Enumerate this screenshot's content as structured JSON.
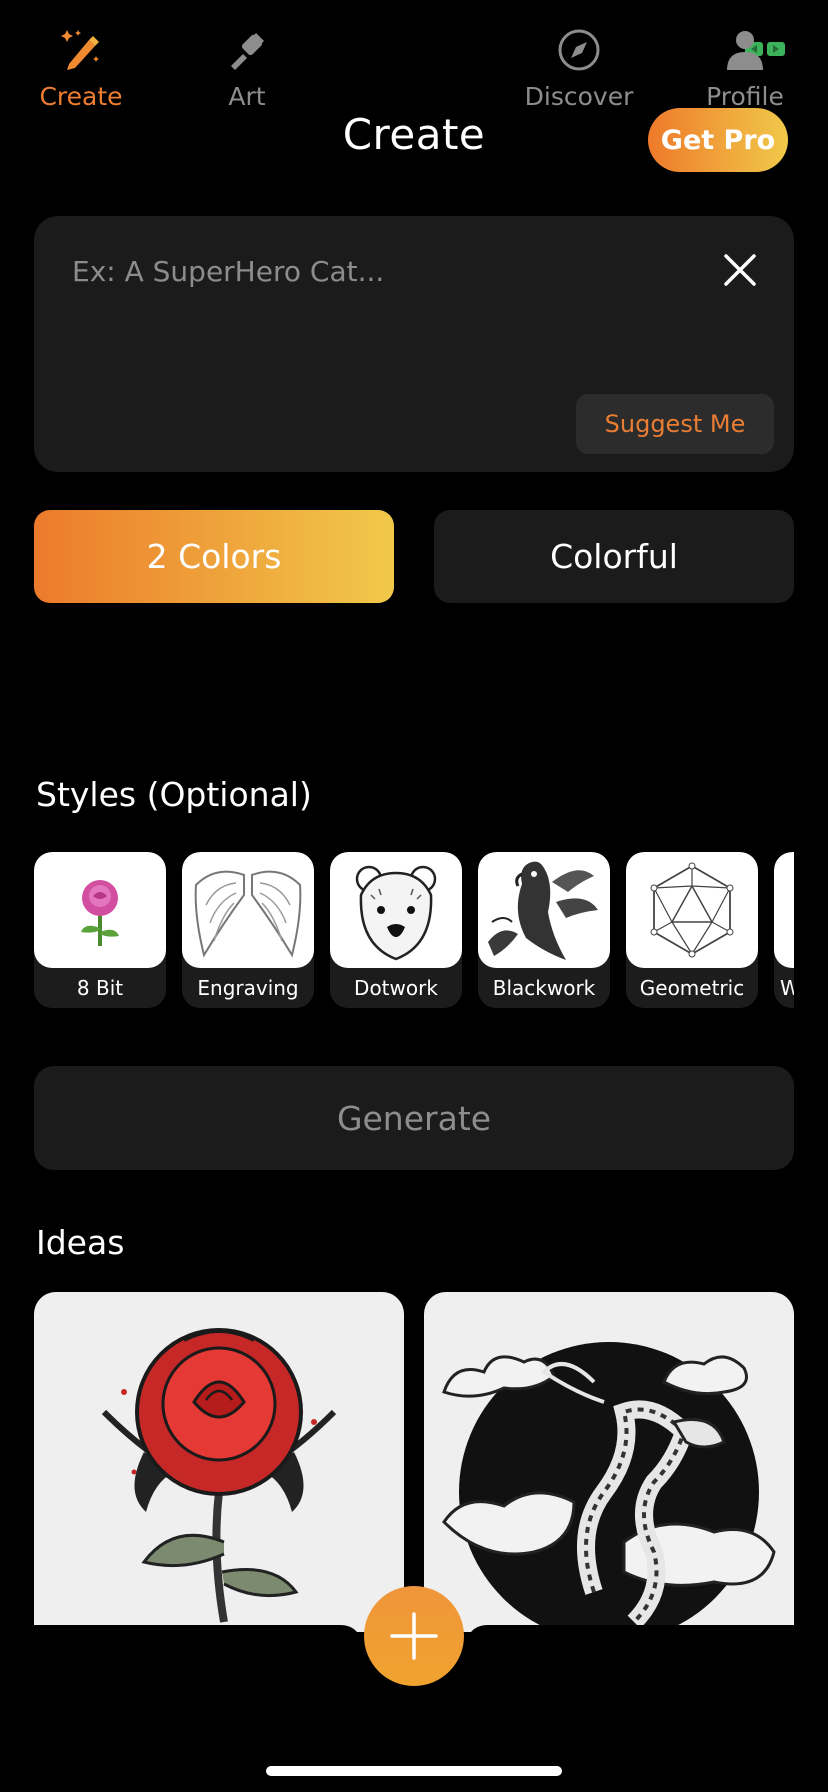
{
  "header": {
    "title": "Create",
    "pro_button": "Get Pro"
  },
  "prompt": {
    "placeholder": "Ex: A SuperHero Cat...",
    "value": "",
    "suggest_label": "Suggest Me"
  },
  "color_modes": {
    "active": "2 Colors",
    "inactive": "Colorful"
  },
  "styles": {
    "title": "Styles (Optional)",
    "items": [
      {
        "label": "8 Bit",
        "icon": "rose-icon"
      },
      {
        "label": "Engraving",
        "icon": "wings-icon"
      },
      {
        "label": "Dotwork",
        "icon": "bear-icon"
      },
      {
        "label": "Blackwork",
        "icon": "parrot-icon"
      },
      {
        "label": "Geometric",
        "icon": "geometric-icon"
      },
      {
        "label": "W",
        "icon": "partial-icon"
      }
    ]
  },
  "generate_label": "Generate",
  "ideas": {
    "title": "Ideas",
    "items": [
      {
        "image": "rose-tattoo"
      },
      {
        "image": "dragon-tattoo"
      }
    ]
  },
  "tabs": [
    {
      "label": "Create",
      "icon": "magic-pen-icon",
      "active": true
    },
    {
      "label": "Art",
      "icon": "tattoo-machine-icon",
      "active": false
    },
    {
      "label": "Discover",
      "icon": "compass-icon",
      "active": false
    },
    {
      "label": "Profile",
      "icon": "person-icon",
      "active": false
    }
  ],
  "colors": {
    "accent_start": "#ec7a2b",
    "accent_end": "#f1c94a",
    "surface": "#1b1b1b",
    "background": "#000000"
  }
}
